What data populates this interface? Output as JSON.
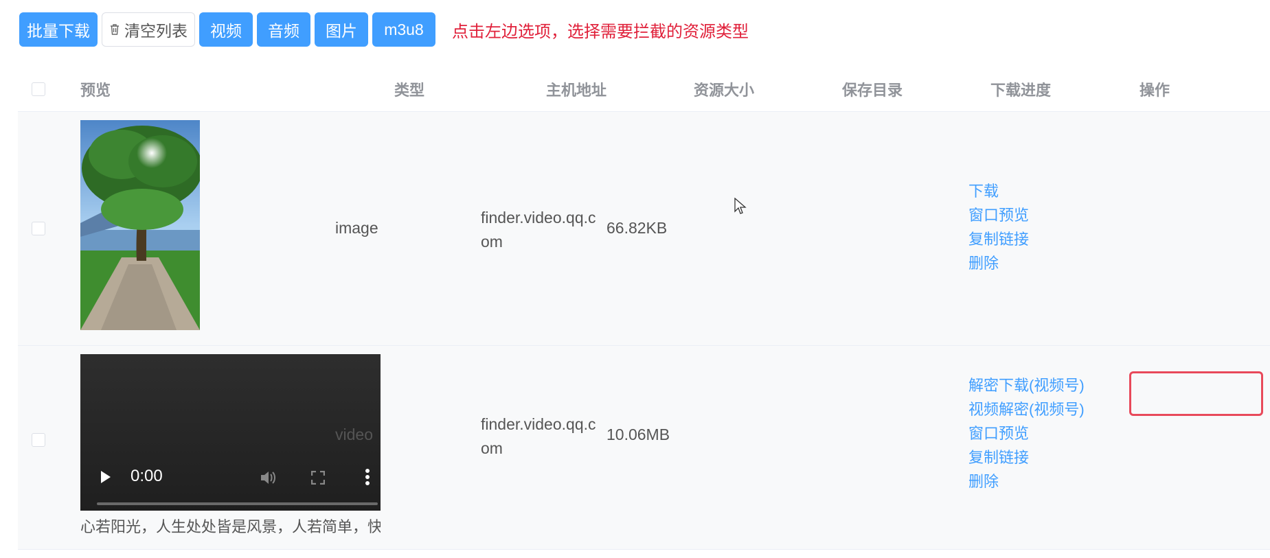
{
  "toolbar": {
    "batch_download": "批量下载",
    "clear_list": "清空列表",
    "video": "视频",
    "audio": "音频",
    "image": "图片",
    "m3u8": "m3u8",
    "hint": "点击左边选项，选择需要拦截的资源类型"
  },
  "columns": {
    "preview": "预览",
    "type": "类型",
    "host": "主机地址",
    "size": "资源大小",
    "save_dir": "保存目录",
    "progress": "下载进度",
    "actions": "操作"
  },
  "rows": [
    {
      "type": "image",
      "host_line1": "finder.video.qq.c",
      "host_line2": "om",
      "size": "66.82KB",
      "actions": [
        "下载",
        "窗口预览",
        "复制链接",
        "删除"
      ]
    },
    {
      "type": "video",
      "host_line1": "finder.video.qq.com",
      "host_line2": "om",
      "size": "10.06MB",
      "video_time": "0:00",
      "caption": "心若阳光，人生处处皆是风景，人若简单，快乐",
      "actions": [
        "解密下载(视频号)",
        "视频解密(视频号)",
        "窗口预览",
        "复制链接",
        "删除"
      ]
    }
  ],
  "colors": {
    "primary": "#409eff",
    "hint": "#e0203a",
    "highlight": "#e8495a"
  }
}
